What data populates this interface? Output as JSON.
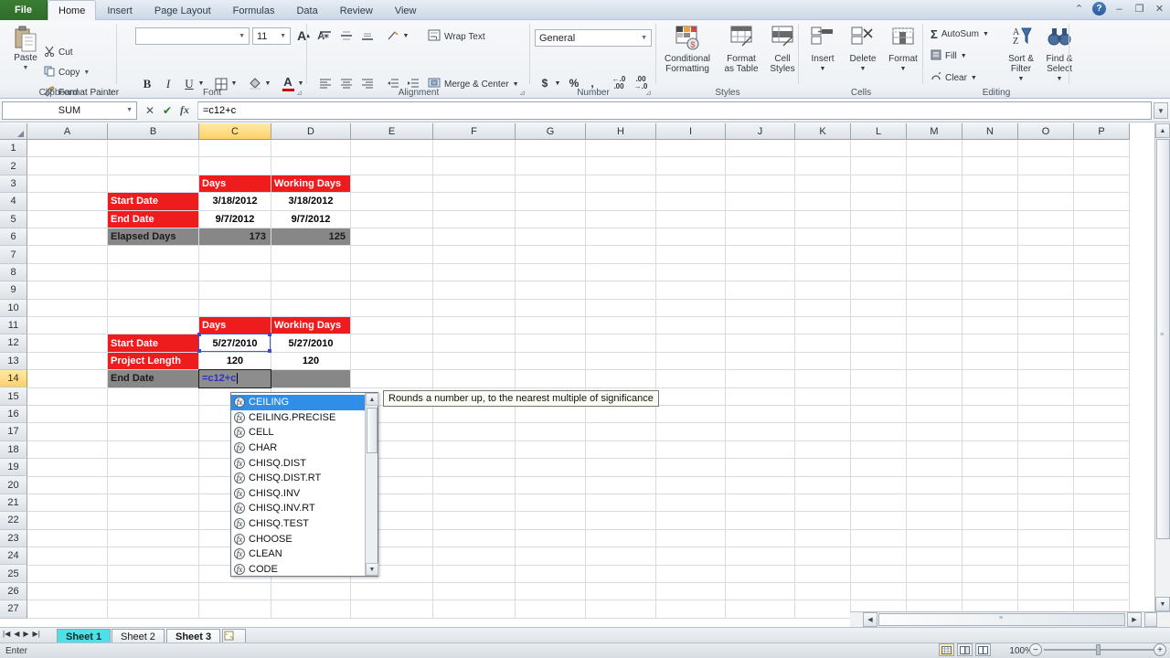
{
  "window": {
    "controls": [
      "minimize-ribbon",
      "help",
      "minimize",
      "restore",
      "close"
    ],
    "minimize_ribbon_glyph": "⌃",
    "help_glyph": "?",
    "minimize_glyph": "–",
    "restore_glyph": "❐",
    "close_glyph": "✕"
  },
  "ribbon": {
    "file_tab": "File",
    "tabs": [
      {
        "label": "Home",
        "active": true
      },
      {
        "label": "Insert",
        "active": false
      },
      {
        "label": "Page Layout",
        "active": false
      },
      {
        "label": "Formulas",
        "active": false
      },
      {
        "label": "Data",
        "active": false
      },
      {
        "label": "Review",
        "active": false
      },
      {
        "label": "View",
        "active": false
      }
    ],
    "groups": {
      "clipboard": {
        "label": "Clipboard",
        "paste": "Paste",
        "cut": "Cut",
        "copy": "Copy",
        "format_painter": "Format Painter"
      },
      "font": {
        "label": "Font",
        "font_name": "",
        "font_size": "11",
        "bold": "B",
        "italic": "I",
        "underline": "U",
        "borders": "borders",
        "fill_color": "fill-color",
        "font_color": "font-color",
        "grow_font": "A",
        "shrink_font": "A"
      },
      "alignment": {
        "label": "Alignment",
        "wrap_text": "Wrap Text",
        "merge_center": "Merge & Center"
      },
      "number": {
        "label": "Number",
        "format": "General",
        "currency": "$",
        "percent": "%",
        "comma": ",",
        "increase_decimal": ".00",
        "decrease_decimal": ".00"
      },
      "styles": {
        "label": "Styles",
        "conditional_formatting": "Conditional\nFormatting",
        "conditional_formatting_l1": "Conditional",
        "conditional_formatting_l2": "Formatting",
        "format_as_table_l1": "Format",
        "format_as_table_l2": "as Table",
        "cell_styles_l1": "Cell",
        "cell_styles_l2": "Styles"
      },
      "cells": {
        "label": "Cells",
        "insert": "Insert",
        "delete": "Delete",
        "format": "Format"
      },
      "editing": {
        "label": "Editing",
        "autosum": "AutoSum",
        "fill": "Fill",
        "clear": "Clear",
        "sort_filter_l1": "Sort &",
        "sort_filter_l2": "Filter",
        "find_select_l1": "Find &",
        "find_select_l2": "Select"
      }
    }
  },
  "formula_bar": {
    "name_box": "SUM",
    "formula": "=c12+c",
    "cancel_glyph": "✕",
    "enter_glyph": "✔",
    "insert_function_glyph": "fx"
  },
  "grid": {
    "columns": [
      "A",
      "B",
      "C",
      "D",
      "E",
      "F",
      "G",
      "H",
      "I",
      "J",
      "K",
      "L",
      "M",
      "N",
      "O",
      "P"
    ],
    "selected_column": "C",
    "rows": [
      1,
      2,
      3,
      4,
      5,
      6,
      7,
      8,
      9,
      10,
      11,
      12,
      13,
      14,
      15,
      16,
      17,
      18,
      19,
      20,
      21,
      22,
      23,
      24,
      25,
      26,
      27
    ],
    "selected_row": 14,
    "active_cell": "C14",
    "reference_cell": "C12",
    "cells": [
      {
        "ref": "C3",
        "row": 3,
        "col": "C",
        "text": "Days",
        "style": "red",
        "align": "left"
      },
      {
        "ref": "D3",
        "row": 3,
        "col": "D",
        "text": "Working Days",
        "style": "red",
        "align": "left"
      },
      {
        "ref": "B4",
        "row": 4,
        "col": "B",
        "text": "Start Date",
        "style": "red",
        "align": "left"
      },
      {
        "ref": "C4",
        "row": 4,
        "col": "C",
        "text": "3/18/2012",
        "style": "white",
        "align": "center"
      },
      {
        "ref": "D4",
        "row": 4,
        "col": "D",
        "text": "3/18/2012",
        "style": "white",
        "align": "center"
      },
      {
        "ref": "B5",
        "row": 5,
        "col": "B",
        "text": "End Date",
        "style": "red",
        "align": "left"
      },
      {
        "ref": "C5",
        "row": 5,
        "col": "C",
        "text": "9/7/2012",
        "style": "white",
        "align": "center"
      },
      {
        "ref": "D5",
        "row": 5,
        "col": "D",
        "text": "9/7/2012",
        "style": "white",
        "align": "center"
      },
      {
        "ref": "B6",
        "row": 6,
        "col": "B",
        "text": "Elapsed Days",
        "style": "gray",
        "align": "left"
      },
      {
        "ref": "C6",
        "row": 6,
        "col": "C",
        "text": "173",
        "style": "gray",
        "align": "right"
      },
      {
        "ref": "D6",
        "row": 6,
        "col": "D",
        "text": "125",
        "style": "gray",
        "align": "right"
      },
      {
        "ref": "C11",
        "row": 11,
        "col": "C",
        "text": "Days",
        "style": "red",
        "align": "left"
      },
      {
        "ref": "D11",
        "row": 11,
        "col": "D",
        "text": "Working Days",
        "style": "red",
        "align": "left"
      },
      {
        "ref": "B12",
        "row": 12,
        "col": "B",
        "text": "Start Date",
        "style": "red",
        "align": "left"
      },
      {
        "ref": "C12",
        "row": 12,
        "col": "C",
        "text": "5/27/2010",
        "style": "white",
        "align": "center"
      },
      {
        "ref": "D12",
        "row": 12,
        "col": "D",
        "text": "5/27/2010",
        "style": "white",
        "align": "center"
      },
      {
        "ref": "B13",
        "row": 13,
        "col": "B",
        "text": "Project Length",
        "style": "red",
        "align": "left"
      },
      {
        "ref": "C13",
        "row": 13,
        "col": "C",
        "text": "120",
        "style": "white",
        "align": "center"
      },
      {
        "ref": "D13",
        "row": 13,
        "col": "D",
        "text": "120",
        "style": "white",
        "align": "center"
      },
      {
        "ref": "B14",
        "row": 14,
        "col": "B",
        "text": "End Date",
        "style": "gray",
        "align": "left"
      },
      {
        "ref": "D14",
        "row": 14,
        "col": "D",
        "text": "",
        "style": "gray",
        "align": "left"
      }
    ],
    "edit_cell_text": "=c12+c"
  },
  "autocomplete": {
    "items": [
      {
        "label": "CEILING",
        "selected": true
      },
      {
        "label": "CEILING.PRECISE",
        "selected": false
      },
      {
        "label": "CELL",
        "selected": false
      },
      {
        "label": "CHAR",
        "selected": false
      },
      {
        "label": "CHISQ.DIST",
        "selected": false
      },
      {
        "label": "CHISQ.DIST.RT",
        "selected": false
      },
      {
        "label": "CHISQ.INV",
        "selected": false
      },
      {
        "label": "CHISQ.INV.RT",
        "selected": false
      },
      {
        "label": "CHISQ.TEST",
        "selected": false
      },
      {
        "label": "CHOOSE",
        "selected": false
      },
      {
        "label": "CLEAN",
        "selected": false
      },
      {
        "label": "CODE",
        "selected": false
      }
    ],
    "tooltip": "Rounds a number up, to the nearest multiple of significance"
  },
  "sheets": {
    "tabs": [
      {
        "label": "Sheet 1",
        "active": true
      },
      {
        "label": "Sheet 2",
        "active": false
      },
      {
        "label": "Sheet 3",
        "active": false
      }
    ],
    "nav_first": "⏮",
    "nav_prev": "◀",
    "nav_next": "▶",
    "nav_last": "⏭",
    "insert_sheet": "insert-sheet"
  },
  "status": {
    "mode": "Enter",
    "zoom": "100%",
    "view_normal": "normal-view",
    "view_page_layout": "page-layout-view",
    "view_page_break": "page-break-view",
    "zoom_out": "−",
    "zoom_in": "+"
  },
  "colors": {
    "accent_red": "#ee1c1c",
    "accent_gray": "#878787",
    "selection_gold": "#fcd268",
    "autocomplete_blue": "#2f8fe8",
    "sheet_active": "#4ee0e8",
    "file_tab_green": "#3a7d33"
  }
}
